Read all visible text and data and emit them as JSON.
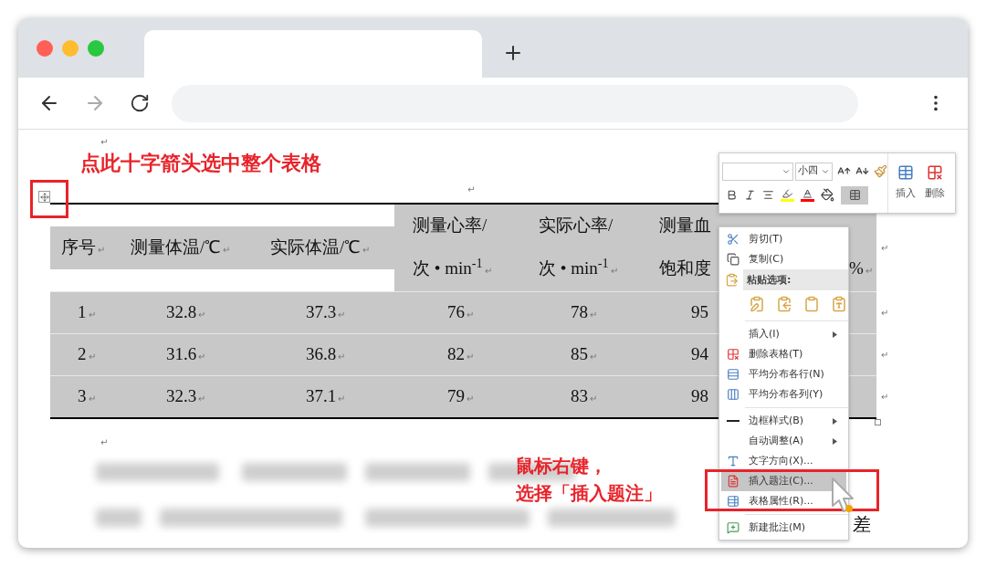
{
  "document": {
    "top_mark": "↵",
    "annotation_top": "点此十字箭头选中整个表格",
    "heading_mark": "↵",
    "table": {
      "header": [
        {
          "kind": "single",
          "lines": [
            "序号"
          ],
          "mark": "↵"
        },
        {
          "kind": "single",
          "lines": [
            "测量体温/℃"
          ],
          "mark": "↵"
        },
        {
          "kind": "single",
          "lines": [
            "实际体温/℃"
          ],
          "mark": "↵"
        },
        {
          "kind": "double",
          "lines": [
            "测量心率/",
            "次 • min$^{-1}$"
          ],
          "mark": "↵"
        },
        {
          "kind": "double",
          "lines": [
            "实际心率/",
            "次 • min$^{-1}$"
          ],
          "mark": "↵"
        },
        {
          "kind": "double",
          "lines": [
            "测量血",
            "饱和度"
          ]
        },
        {
          "kind": "double",
          "lines": [
            "%"
          ],
          "mark": "↵"
        }
      ],
      "header_end_mark": "↵",
      "rows": [
        {
          "cells": [
            {
              "text": "1",
              "mark": "↵"
            },
            {
              "text": "32.8",
              "mark": "↵"
            },
            {
              "text": "37.3",
              "mark": "↵"
            },
            {
              "text": "76",
              "mark": "↵"
            },
            {
              "text": "78",
              "mark": "↵"
            },
            {
              "text": "95"
            }
          ],
          "end_mark": "↵"
        },
        {
          "cells": [
            {
              "text": "2",
              "mark": "↵"
            },
            {
              "text": "31.6",
              "mark": "↵"
            },
            {
              "text": "36.8",
              "mark": "↵"
            },
            {
              "text": "82",
              "mark": "↵"
            },
            {
              "text": "85",
              "mark": "↵"
            },
            {
              "text": "94"
            }
          ],
          "end_mark": "↵"
        },
        {
          "cells": [
            {
              "text": "3",
              "mark": "↵"
            },
            {
              "text": "32.3",
              "mark": "↵"
            },
            {
              "text": "37.1",
              "mark": "↵"
            },
            {
              "text": "79",
              "mark": "↵"
            },
            {
              "text": "83",
              "mark": "↵"
            },
            {
              "text": "98"
            }
          ],
          "end_mark": "↵"
        }
      ]
    },
    "after_table_mark": "↵",
    "annotation_bottom": [
      "鼠标右键，",
      "选择「插入题注」"
    ],
    "trailing_text": "差"
  },
  "mini_toolbar": {
    "font_size": "小四",
    "insert_label": "插入",
    "delete_label": "删除"
  },
  "context_menu": {
    "items": [
      {
        "kind": "item",
        "label": "剪切(T)",
        "selected": false
      },
      {
        "kind": "item",
        "label": "复制(C)",
        "selected": false
      },
      {
        "kind": "header",
        "label": "粘贴选项:"
      },
      {
        "kind": "paste_row"
      },
      {
        "kind": "separator"
      },
      {
        "kind": "submenu",
        "label": "插入(I)",
        "selected": false
      },
      {
        "kind": "item",
        "label": "删除表格(T)",
        "selected": false
      },
      {
        "kind": "item",
        "label": "平均分布各行(N)",
        "selected": false
      },
      {
        "kind": "item",
        "label": "平均分布各列(Y)",
        "selected": false
      },
      {
        "kind": "separator"
      },
      {
        "kind": "submenu",
        "label": "边框样式(B)",
        "selected": false
      },
      {
        "kind": "submenu",
        "label": "自动调整(A)",
        "selected": false
      },
      {
        "kind": "item",
        "label": "文字方向(X)...",
        "selected": false
      },
      {
        "kind": "item",
        "label": "插入题注(C)...",
        "selected": true
      },
      {
        "kind": "item",
        "label": "表格属性(R)...",
        "selected": false
      },
      {
        "kind": "separator"
      },
      {
        "kind": "item",
        "label": "新建批注(M)",
        "selected": false
      }
    ]
  }
}
